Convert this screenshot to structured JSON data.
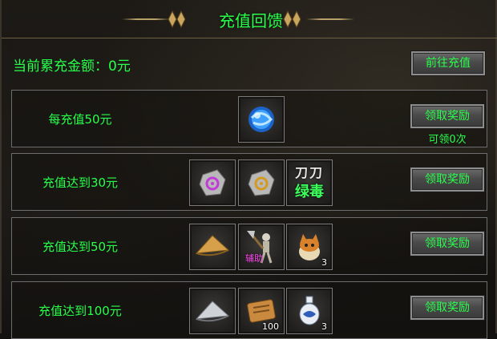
{
  "header": {
    "title": "充值回馈"
  },
  "summary": {
    "total_label": "当前累充金额：0元"
  },
  "buttons": {
    "go_recharge": "前往充值",
    "claim": "领取奖励"
  },
  "rows": [
    {
      "label": "每充值50元",
      "note": "可领0次",
      "items": [
        {
          "icon": "blue-orb-icon"
        }
      ]
    },
    {
      "label": "充值达到30元",
      "items": [
        {
          "icon": "purple-rune-stone-icon"
        },
        {
          "icon": "gold-rune-stone-icon"
        },
        {
          "icon": "seal-text-icon",
          "seal_top": "刀刀",
          "seal_bottom": "绿毒"
        }
      ]
    },
    {
      "label": "充值达到50元",
      "items": [
        {
          "icon": "straw-hat-icon"
        },
        {
          "icon": "skeleton-axe-warrior-icon",
          "tag": "辅助"
        },
        {
          "icon": "fox-pet-icon",
          "qty": "3"
        }
      ]
    },
    {
      "label": "充值达到100元",
      "items": [
        {
          "icon": "bamboo-hat-icon"
        },
        {
          "icon": "scroll-icon",
          "qty": "100"
        },
        {
          "icon": "porcelain-vase-icon",
          "qty": "3"
        }
      ]
    }
  ],
  "colors": {
    "accent_green": "#28ff4a",
    "gold_line": "#b9a06a"
  }
}
